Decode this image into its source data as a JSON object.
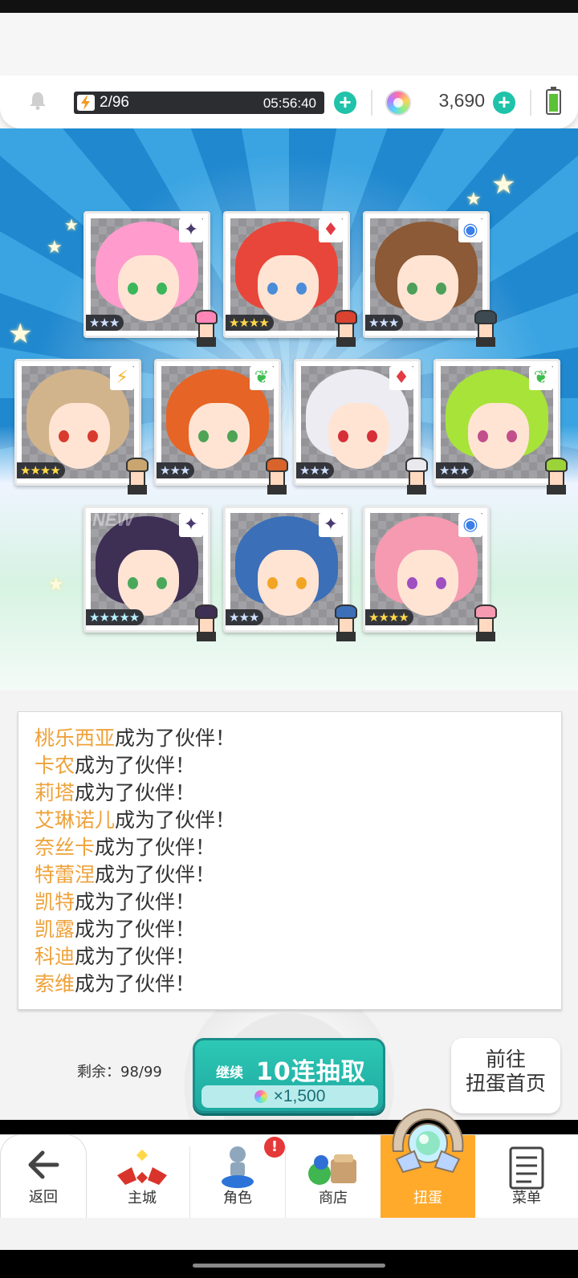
{
  "status": {
    "stamina": "2/96",
    "stamina_timer": "05:56:40",
    "gems": "3,690"
  },
  "cards": [
    {
      "stars": "★★★",
      "stars_color": "#cfe0ff",
      "element": "✦",
      "element_color": "#4a3a6e",
      "hair": "#ff9ccd",
      "eye": "#3cb65a",
      "sprite_hair": "#ff86b6"
    },
    {
      "stars": "★★★★",
      "stars_color": "#ffd84a",
      "element": "♦",
      "element_color": "#e23b44",
      "hair": "#e8463a",
      "eye": "#4a8cd8",
      "sprite_hair": "#d9432f"
    },
    {
      "stars": "★★★",
      "stars_color": "#cfe0ff",
      "element": "◉",
      "element_color": "#3a7ee8",
      "hair": "#8c5a36",
      "eye": "#4ca05a",
      "sprite_hair": "#3d4a52"
    },
    {
      "stars": "★★★★",
      "stars_color": "#ffd84a",
      "element": "⚡",
      "element_color": "#f2b526",
      "hair": "#d2b48c",
      "eye": "#d93a2e",
      "sprite_hair": "#c9a56f"
    },
    {
      "stars": "★★★",
      "stars_color": "#cfe0ff",
      "element": "❦",
      "element_color": "#3ebd4e",
      "hair": "#e66425",
      "eye": "#4ea454",
      "sprite_hair": "#d9642b"
    },
    {
      "stars": "★★★",
      "stars_color": "#cfe0ff",
      "element": "♦",
      "element_color": "#e23b44",
      "hair": "#ececf2",
      "eye": "#d62f38",
      "sprite_hair": "#e9e9ee"
    },
    {
      "stars": "★★★",
      "stars_color": "#cfe0ff",
      "element": "❦",
      "element_color": "#3ebd4e",
      "hair": "#a8e33a",
      "eye": "#c24f8c",
      "sprite_hair": "#9bd339"
    },
    {
      "stars": "★★★★★",
      "stars_color": "#b8f0ff",
      "element": "✦",
      "element_color": "#4a3a6e",
      "hair": "#3e2f55",
      "eye": "#4aa85a",
      "sprite_hair": "#3e2f55",
      "new": "NEW"
    },
    {
      "stars": "★★★",
      "stars_color": "#cfe0ff",
      "element": "✦",
      "element_color": "#4a3a6e",
      "hair": "#3b6fb8",
      "eye": "#f2a524",
      "sprite_hair": "#3b6fb8"
    },
    {
      "stars": "★★★★",
      "stars_color": "#ffd84a",
      "element": "◉",
      "element_color": "#3a7ee8",
      "hair": "#f59ab0",
      "eye": "#a04fc2",
      "sprite_hair": "#f59ab0"
    }
  ],
  "log": [
    {
      "name": "桃乐西亚",
      "text": "成为了伙伴！"
    },
    {
      "name": "卡农",
      "text": "成为了伙伴！"
    },
    {
      "name": "莉塔",
      "text": "成为了伙伴！"
    },
    {
      "name": "艾琳诺儿",
      "text": "成为了伙伴！"
    },
    {
      "name": "奈丝卡",
      "text": "成为了伙伴！"
    },
    {
      "name": "特蕾涅",
      "text": "成为了伙伴！"
    },
    {
      "name": "凯特",
      "text": "成为了伙伴！"
    },
    {
      "name": "凯露",
      "text": "成为了伙伴！"
    },
    {
      "name": "科迪",
      "text": "成为了伙伴！"
    },
    {
      "name": "索维",
      "text": "成为了伙伴！"
    }
  ],
  "draw": {
    "remain": "剩余：98/99",
    "continue_label": "继续",
    "main_label": "10连抽取",
    "cost": "×1,500",
    "goto_line1": "前往",
    "goto_line2": "扭蛋首页"
  },
  "nav": {
    "back": "返回",
    "tabs": [
      "主城",
      "角色",
      "商店",
      "扭蛋",
      "菜单"
    ],
    "active": "扭蛋",
    "badge": "!"
  },
  "colors": {
    "accent_teal": "#20c3a9",
    "tab_active": "#ffaa2b",
    "name_orange": "#eea23a"
  }
}
